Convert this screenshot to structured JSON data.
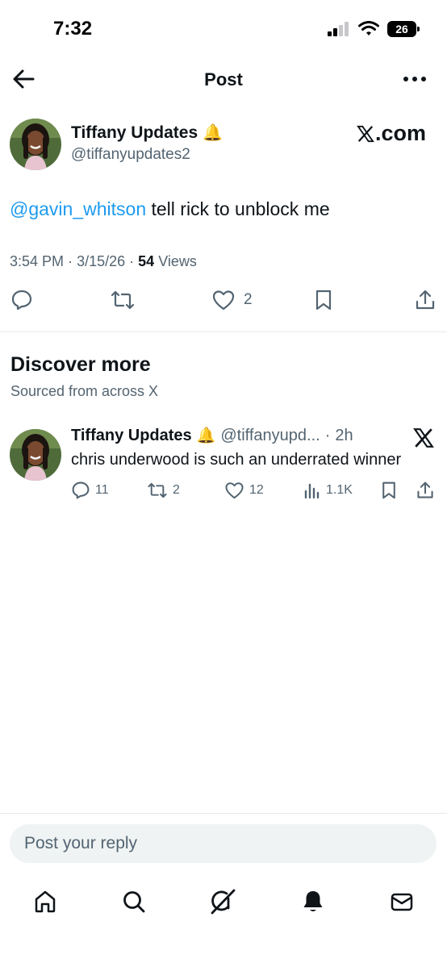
{
  "status_bar": {
    "time": "7:32",
    "battery": "26"
  },
  "header": {
    "title": "Post"
  },
  "post": {
    "author_name": "Tiffany Updates",
    "author_emoji": "🔔",
    "handle": "@tiffanyupdates2",
    "source_badge": ".com",
    "mention": "@gavin_whitson",
    "text": " tell rick to unblock me",
    "time": "3:54 PM",
    "date": "3/15/26",
    "views_count": "54",
    "views_label": "Views",
    "likes": "2"
  },
  "discover": {
    "title": "Discover more",
    "subtitle": "Sourced from across X"
  },
  "feed": [
    {
      "author_name": "Tiffany Updates",
      "author_emoji": "🔔",
      "handle": "@tiffanyupd...",
      "age": "2h",
      "text": "chris underwood is such an underrated winner",
      "replies": "11",
      "reposts": "2",
      "likes": "12",
      "views": "1.1K"
    }
  ],
  "reply": {
    "placeholder": "Post your reply"
  },
  "icons": {
    "back": "arrow-left-icon",
    "more": "more-icon",
    "reply": "comment-icon",
    "repost": "repost-icon",
    "like": "heart-icon",
    "bookmark": "bookmark-icon",
    "share": "share-icon",
    "views": "views-chart-icon",
    "home": "home-icon",
    "search": "search-icon",
    "grok": "grok-icon",
    "notifications": "bell-icon",
    "messages": "mail-icon"
  },
  "colors": {
    "accent": "#1d9bf0",
    "text": "#0f1419",
    "secondary": "#536471"
  }
}
